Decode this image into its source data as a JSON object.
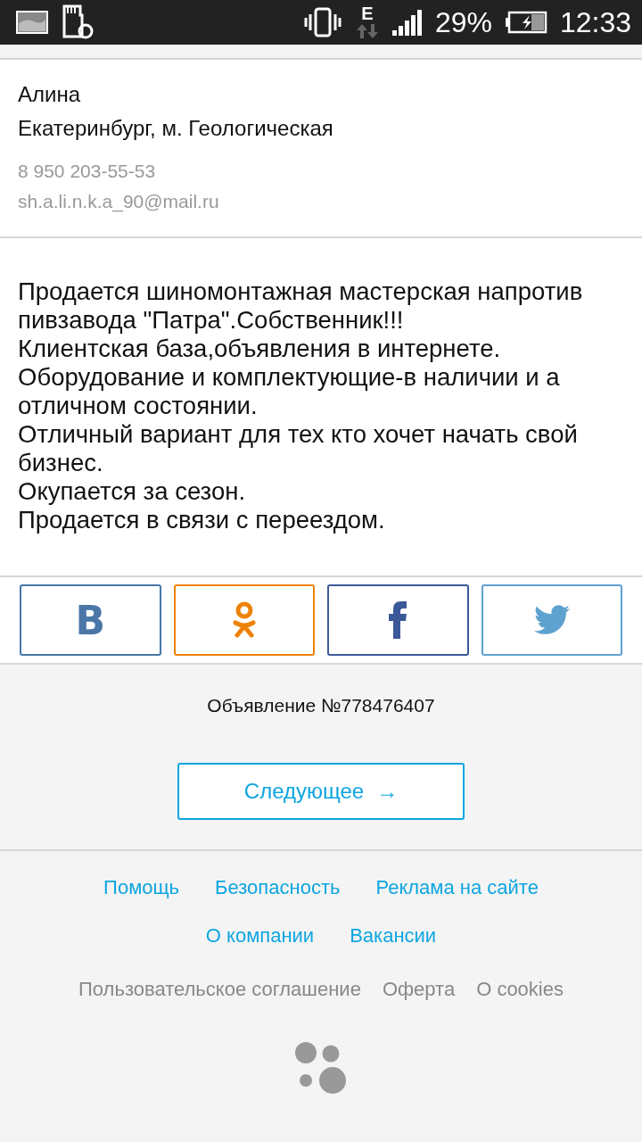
{
  "status_bar": {
    "network": "E",
    "battery": "29%",
    "time": "12:33"
  },
  "contact": {
    "name": "Алина",
    "location": "Екатеринбург, м. Геологическая",
    "phone": "8 950 203-55-53",
    "email": "sh.a.li.n.k.a_90@mail.ru"
  },
  "description": [
    "Продается шиномонтажная мастерская напротив пивзавода \"Патра\".Собственник!!!",
    "Клиентская база,объявления в интернете.",
    "Оборудование и комплектующие-в наличии и а отличном состоянии.",
    "Отличный вариант для тех кто хочет начать свой бизнес.",
    "Окупается за сезон.",
    "Продается в связи с переездом."
  ],
  "share": [
    {
      "kind": "vk",
      "label": "В",
      "color": "#4a76a8"
    },
    {
      "kind": "ok",
      "color": "#ee8208"
    },
    {
      "kind": "fb",
      "color": "#3b5998"
    },
    {
      "kind": "tw",
      "color": "#5ea3d0"
    }
  ],
  "ad_number": "Объявление №778476407",
  "next_button": {
    "label": "Следующее",
    "arrow": "→"
  },
  "footer_links": [
    [
      "Помощь",
      "Безопасность",
      "Реклама на сайте"
    ],
    [
      "О компании",
      "Вакансии"
    ]
  ],
  "footer_secondary": [
    "Пользовательское соглашение",
    "Оферта",
    "О cookies"
  ]
}
